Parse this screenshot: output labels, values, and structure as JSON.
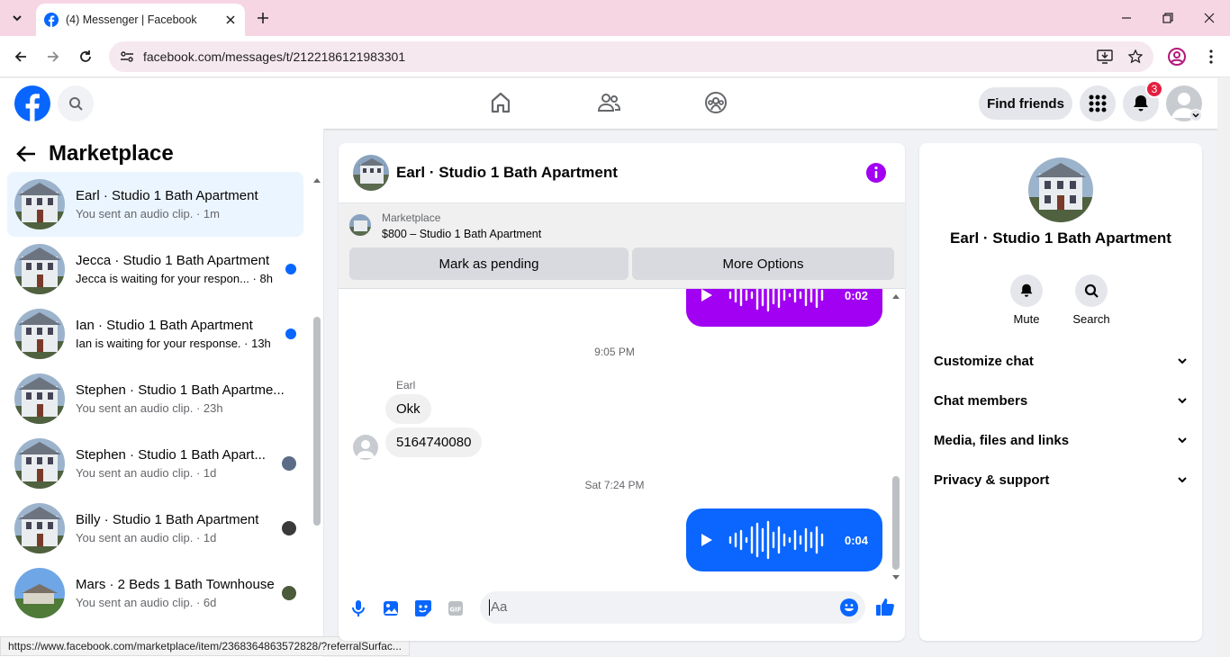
{
  "browser": {
    "tab_title": "(4) Messenger | Facebook",
    "url": "facebook.com/messages/t/2122186121983301",
    "status_url": "https://www.facebook.com/marketplace/item/2368364863572828/?referralSurfac..."
  },
  "header": {
    "find_friends": "Find friends",
    "notifications_count": "3",
    "nav_icons": [
      "home-icon",
      "friends-icon",
      "groups-icon"
    ]
  },
  "sidebar": {
    "title": "Marketplace",
    "conversations": [
      {
        "name": "Earl · Studio 1 Bath Apartment",
        "preview": "You sent an audio clip. · 1m",
        "active": true
      },
      {
        "name": "Jecca · Studio 1 Bath Apartment",
        "preview": "Jecca is waiting for your respon... · 8h",
        "unread": true
      },
      {
        "name": "Ian · Studio 1 Bath Apartment",
        "preview": "Ian is waiting for your response. · 13h",
        "unread": true
      },
      {
        "name": "Stephen · Studio 1 Bath Apartme...",
        "preview": "You sent an audio clip. · 23h"
      },
      {
        "name": "Stephen · Studio 1 Bath Apart...",
        "preview": "You sent an audio clip. · 1d"
      },
      {
        "name": "Billy · Studio 1 Bath Apartment",
        "preview": "You sent an audio clip. · 1d"
      },
      {
        "name": "Mars · 2 Beds 1 Bath Townhouse",
        "preview": "You sent an audio clip. · 6d"
      }
    ]
  },
  "chat": {
    "title": "Earl · Studio 1 Bath Apartment",
    "marketplace_label": "Marketplace",
    "listing": "$800 – Studio 1 Bath Apartment",
    "mark_pending": "Mark as pending",
    "more_options": "More Options",
    "audio1_duration": "0:02",
    "timestamp1": "9:05 PM",
    "sender": "Earl",
    "msg1": "Okk",
    "msg2": "5164740080",
    "timestamp2": "Sat 7:24 PM",
    "audio2_duration": "0:04",
    "input_placeholder": "Aa"
  },
  "details": {
    "name": "Earl · Studio 1 Bath Apartment",
    "mute": "Mute",
    "search": "Search",
    "sections": [
      "Customize chat",
      "Chat members",
      "Media, files and links",
      "Privacy & support"
    ]
  },
  "colors": {
    "accent": "#0866ff",
    "audio_purple": "#a100f2",
    "audio_blue": "#0a66ff"
  }
}
